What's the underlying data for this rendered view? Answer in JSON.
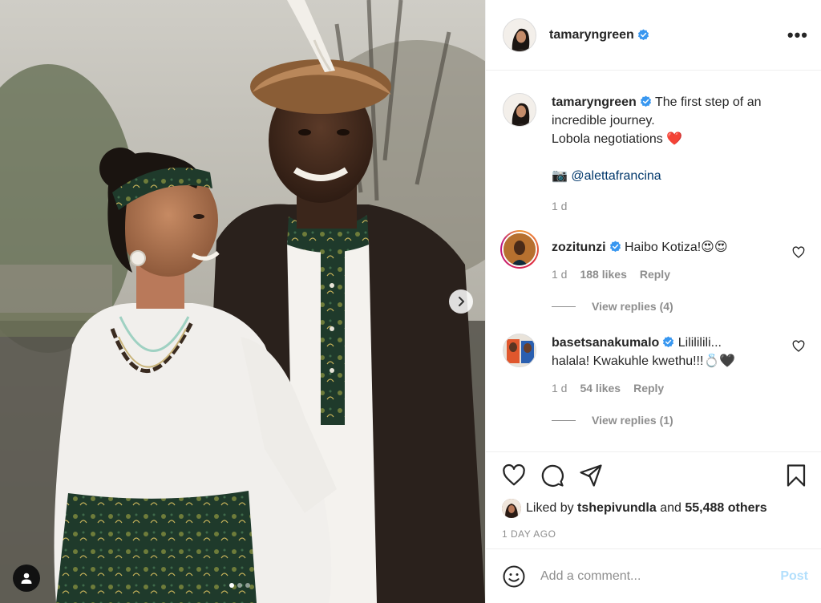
{
  "post": {
    "author": "tamaryngreen",
    "caption_lines": [
      "The first step of an",
      "incredible journey.",
      "Lobola negotiations ❤️"
    ],
    "credit_icon": "📷",
    "credit_mention": "@alettafrancina",
    "caption_age": "1 d",
    "carousel": {
      "slides": 3,
      "active_index": 0
    }
  },
  "comments": [
    {
      "user": "zozitunzi",
      "verified": true,
      "text": "Haibo Kotiza!😍😍",
      "age": "1 d",
      "likes": "188 likes",
      "reply_label": "Reply",
      "view_replies": "View replies (4)",
      "has_story_ring": true
    },
    {
      "user": "basetsanakumalo",
      "verified": true,
      "text_line1": "Lilililili...",
      "text_line2": "halala! Kwakuhle kwethu!!!💍🖤",
      "age": "1 d",
      "likes": "54 likes",
      "reply_label": "Reply",
      "view_replies": "View replies (1)"
    }
  ],
  "engagement": {
    "liked_by_prefix": "Liked by",
    "liked_by_user": "tshepivundla",
    "liked_by_mid": "and",
    "others": "55,488 others",
    "time_ago": "1 DAY AGO"
  },
  "comment_box": {
    "placeholder": "Add a comment...",
    "post_label": "Post"
  },
  "header": {
    "more_label": "•••"
  },
  "colors": {
    "verified": "#3897f0",
    "link": "#00376b",
    "post_disabled": "#b2dffc",
    "muted": "#8e8e8e"
  }
}
